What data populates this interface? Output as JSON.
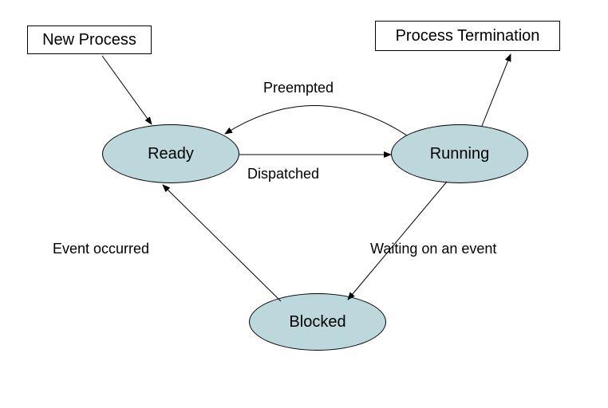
{
  "nodes": {
    "new_process": "New Process",
    "ready": "Ready",
    "running": "Running",
    "blocked": "Blocked",
    "termination": "Process Termination"
  },
  "edges": {
    "preempted": "Preempted",
    "dispatched": "Dispatched",
    "event_occurred": "Event occurred",
    "waiting": "Waiting on an event"
  },
  "colors": {
    "ellipse_fill": "#bcd8dc",
    "stroke": "#000000"
  }
}
